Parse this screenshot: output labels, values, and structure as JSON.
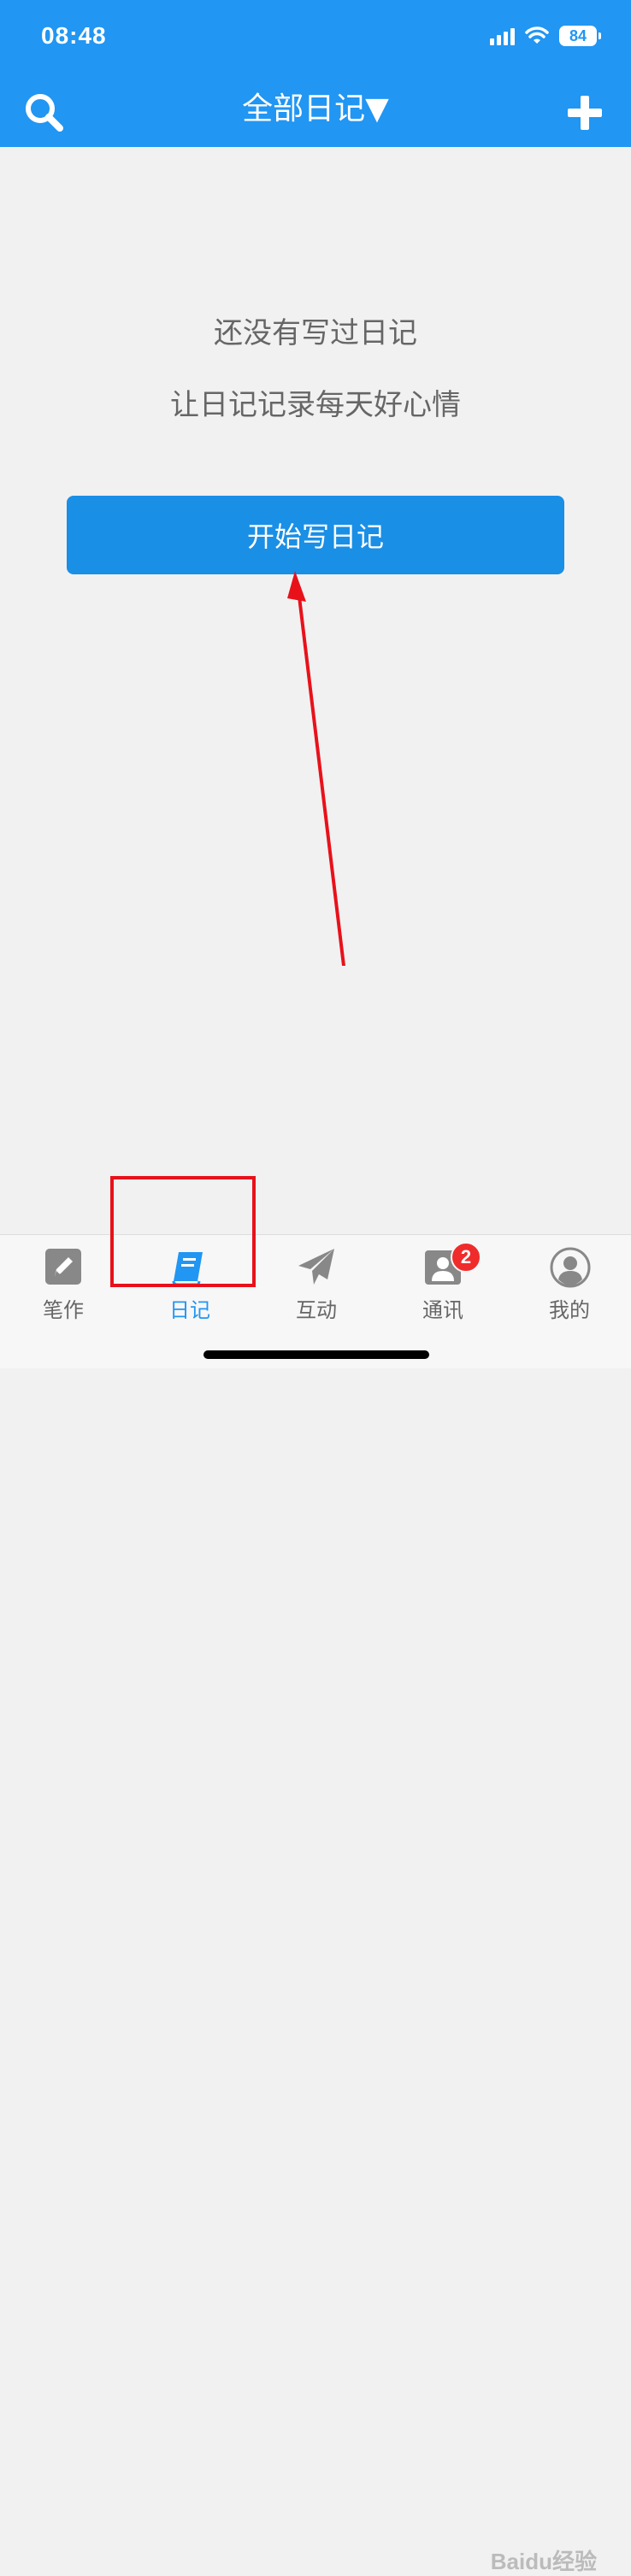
{
  "status_bar": {
    "time": "08:48",
    "battery": "84"
  },
  "nav": {
    "title": "全部日记▼"
  },
  "empty_state": {
    "title": "还没有写过日记",
    "subtitle": "让日记记录每天好心情",
    "button_label": "开始写日记"
  },
  "tabs": [
    {
      "label": "笔作",
      "icon": "pencil-icon",
      "active": false
    },
    {
      "label": "日记",
      "icon": "book-icon",
      "active": true
    },
    {
      "label": "互动",
      "icon": "paper-plane-icon",
      "active": false
    },
    {
      "label": "通讯",
      "icon": "contacts-icon",
      "active": false,
      "badge": "2"
    },
    {
      "label": "我的",
      "icon": "person-icon",
      "active": false
    }
  ],
  "watermark": "Baidu经验",
  "colors": {
    "primary": "#2196f3",
    "button": "#1a8fe6",
    "annotation": "#e8111a",
    "badge": "#f02b2b"
  }
}
